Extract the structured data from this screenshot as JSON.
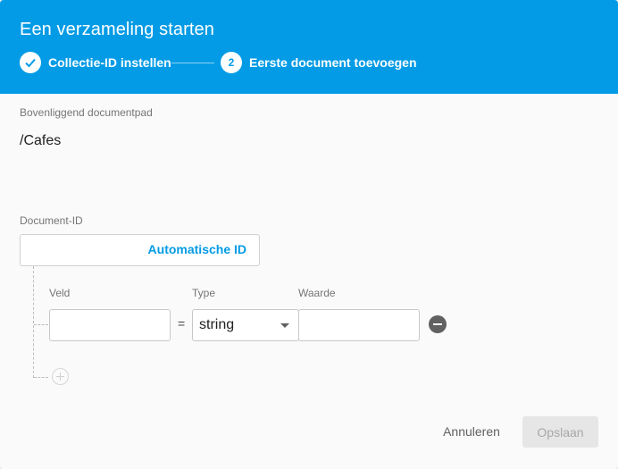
{
  "dialog": {
    "title": "Een verzameling starten",
    "steps": [
      {
        "marker": "check-icon",
        "label": "Collectie-ID instellen",
        "state": "completed"
      },
      {
        "marker": "2",
        "label": "Eerste document toevoegen",
        "state": "active"
      }
    ]
  },
  "parent_path": {
    "label": "Bovenliggend documentpad",
    "value": "/Cafes"
  },
  "document_id": {
    "label": "Document-ID",
    "value": "",
    "auto_id_label": "Automatische ID"
  },
  "fields": {
    "headers": {
      "field": "Veld",
      "type": "Type",
      "value": "Waarde"
    },
    "rows": [
      {
        "field": "",
        "equals": "=",
        "type": "string",
        "value": ""
      }
    ]
  },
  "actions": {
    "cancel_label": "Annuleren",
    "save_label": "Opslaan",
    "save_enabled": false
  },
  "colors": {
    "header_bg": "#039be5",
    "accent": "#039be5"
  }
}
